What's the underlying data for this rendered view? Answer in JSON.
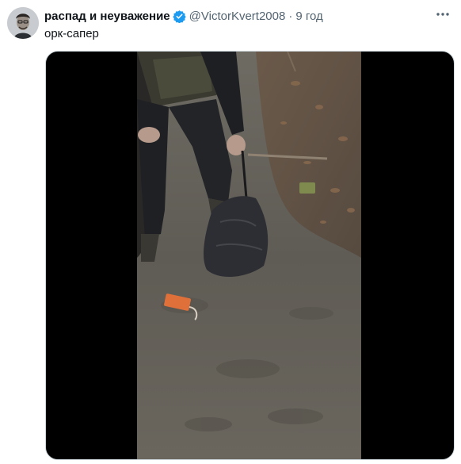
{
  "post": {
    "display_name": "распад и неуважение",
    "handle": "@VictorKvert2008",
    "separator": "·",
    "time": "9 год",
    "text": "орк-сапер"
  },
  "icons": {
    "verified": "verified-badge-icon",
    "more": "more-options-icon"
  },
  "colors": {
    "verified": "#1d9bf0",
    "secondary_text": "#536471",
    "primary_text": "#0f1419",
    "media_background": "#000000"
  }
}
